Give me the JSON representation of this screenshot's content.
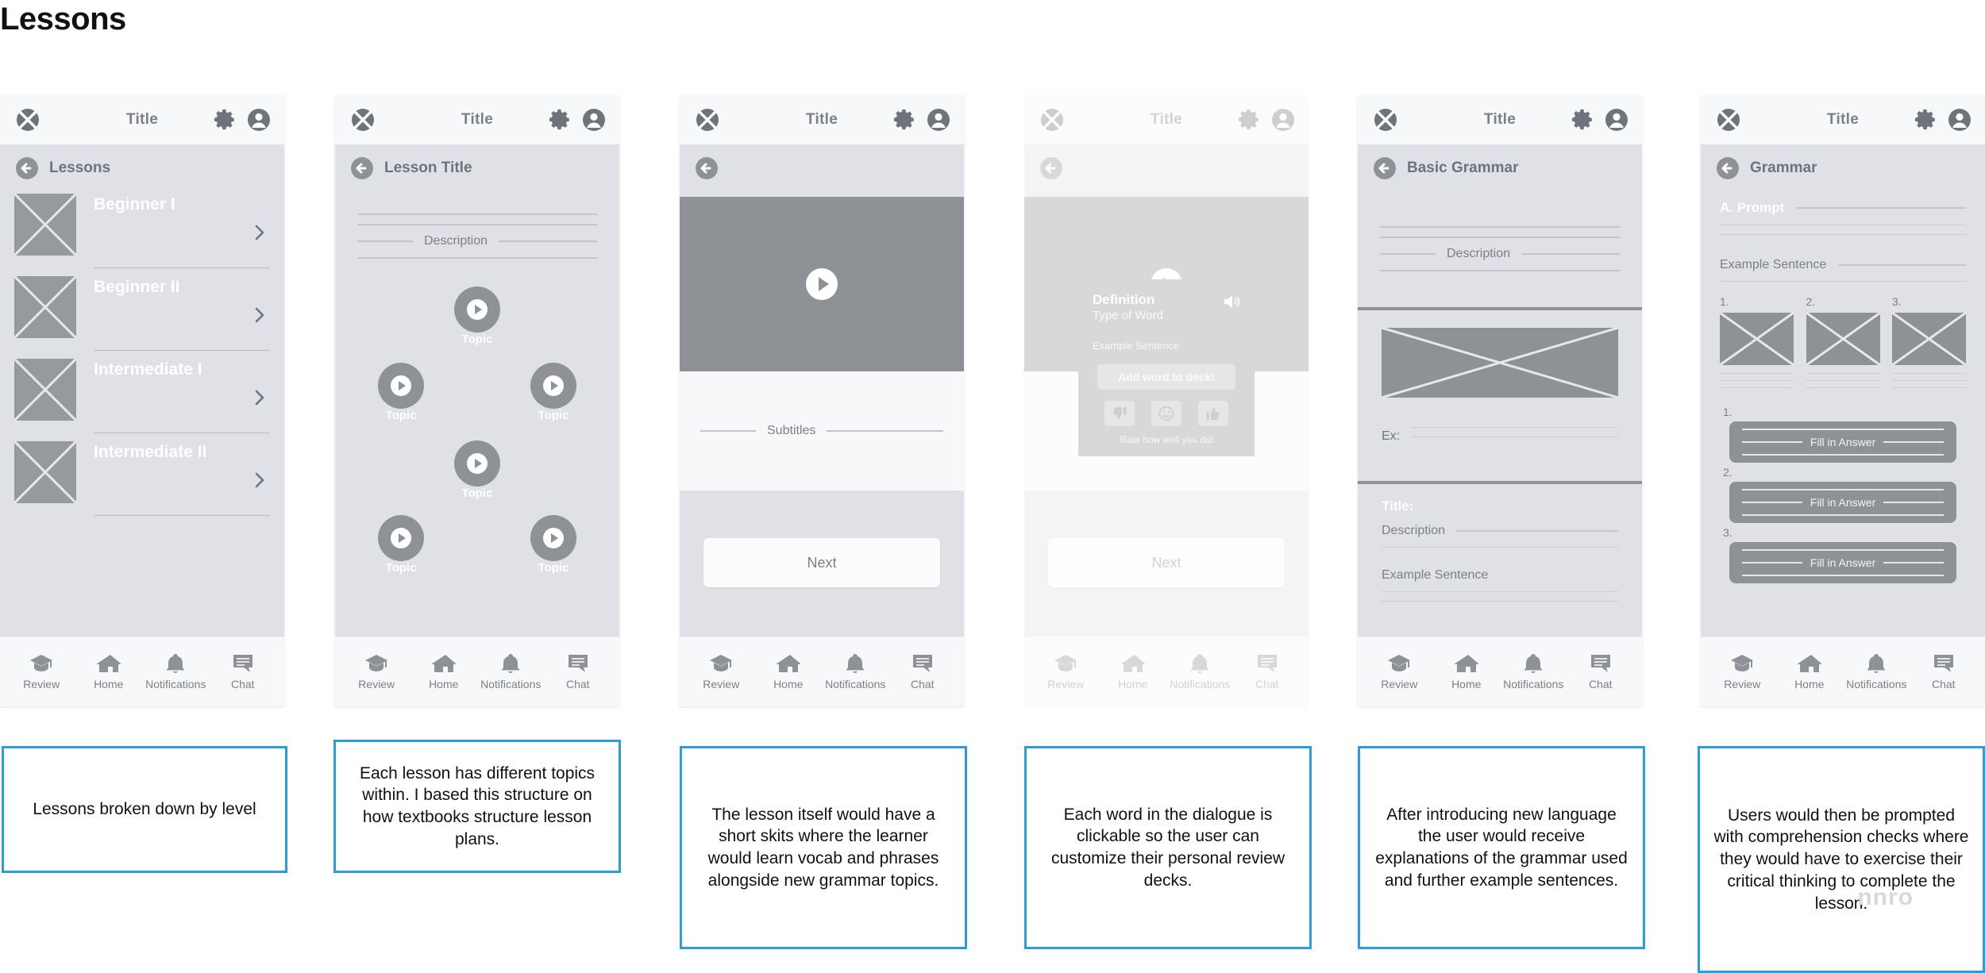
{
  "page": {
    "title": "Lessons",
    "watermark": "nnro"
  },
  "common": {
    "topbar_title": "Title",
    "icons": {
      "close": "close-circle-icon",
      "gear": "gear-icon",
      "user": "account-icon",
      "back": "back-arrow-icon"
    },
    "bottom_nav": [
      {
        "icon": "graduation-cap-icon",
        "label": "Review"
      },
      {
        "icon": "home-icon",
        "label": "Home"
      },
      {
        "icon": "bell-icon",
        "label": "Notifications"
      },
      {
        "icon": "chat-bubble-icon",
        "label": "Chat"
      }
    ]
  },
  "screens": [
    {
      "id": "lessons-list",
      "subheader": "Lessons",
      "lessons": [
        {
          "name": "Beginner I"
        },
        {
          "name": "Beginner II"
        },
        {
          "name": "Intermediate I"
        },
        {
          "name": "Intermediate II"
        }
      ]
    },
    {
      "id": "lesson-title",
      "subheader": "Lesson Title",
      "description_label": "Description",
      "topics": [
        {
          "label": "Topic"
        },
        {
          "label": "Topic"
        },
        {
          "label": "Topic"
        },
        {
          "label": "Topic"
        },
        {
          "label": "Topic"
        },
        {
          "label": "Topic"
        }
      ]
    },
    {
      "id": "lesson-video",
      "subheader": "",
      "subtitles_label": "Subtitles",
      "next_label": "Next"
    },
    {
      "id": "word-definition",
      "modal": {
        "title": "Definition",
        "subtitle": "Type of Word",
        "example": "Example Sentence",
        "add_button": "Add word to deck!",
        "rate_caption": "Rate how well you did",
        "rate_buttons": [
          {
            "icon": "thumbs-down-icon"
          },
          {
            "icon": "neutral-face-icon"
          },
          {
            "icon": "thumbs-up-icon"
          }
        ],
        "speaker_icon": "speaker-icon"
      },
      "next_label": "Next"
    },
    {
      "id": "basic-grammar",
      "subheader": "Basic Grammar",
      "description_label": "Description",
      "example_label": "Ex:",
      "section_title": "Title:",
      "section_description_label": "Description",
      "section_example_label": "Example Sentence"
    },
    {
      "id": "grammar-quiz",
      "subheader": "Grammar",
      "prompt_label": "A. Prompt",
      "example_label": "Example Sentence",
      "choice_numbers": [
        "1.",
        "2.",
        "3."
      ],
      "fill_items": [
        {
          "number": "1.",
          "placeholder": "Fill in Answer"
        },
        {
          "number": "2.",
          "placeholder": "Fill in Answer"
        },
        {
          "number": "3.",
          "placeholder": "Fill in Answer"
        }
      ]
    }
  ],
  "notes": [
    {
      "text": "Lessons broken down by level"
    },
    {
      "text": "Each lesson has different topics within. I based this structure on how textbooks structure lesson plans."
    },
    {
      "text": "The lesson itself would have a short skits where the learner would learn vocab and phrases alongside new grammar topics."
    },
    {
      "text": "Each word in the dialogue is clickable so the user can customize their personal review decks."
    },
    {
      "text": "After introducing new language the user would receive explanations of the grammar used and further example sentences."
    },
    {
      "text": "Users would then be prompted with comprehension checks where they would have to exercise their critical thinking to complete the lesson."
    }
  ],
  "colors": {
    "note_border": "#2d9cdb",
    "screen_bg": "#dfe1e6",
    "bar_bg": "#f7f8f9",
    "placeholder_gray": "#8e9296"
  }
}
